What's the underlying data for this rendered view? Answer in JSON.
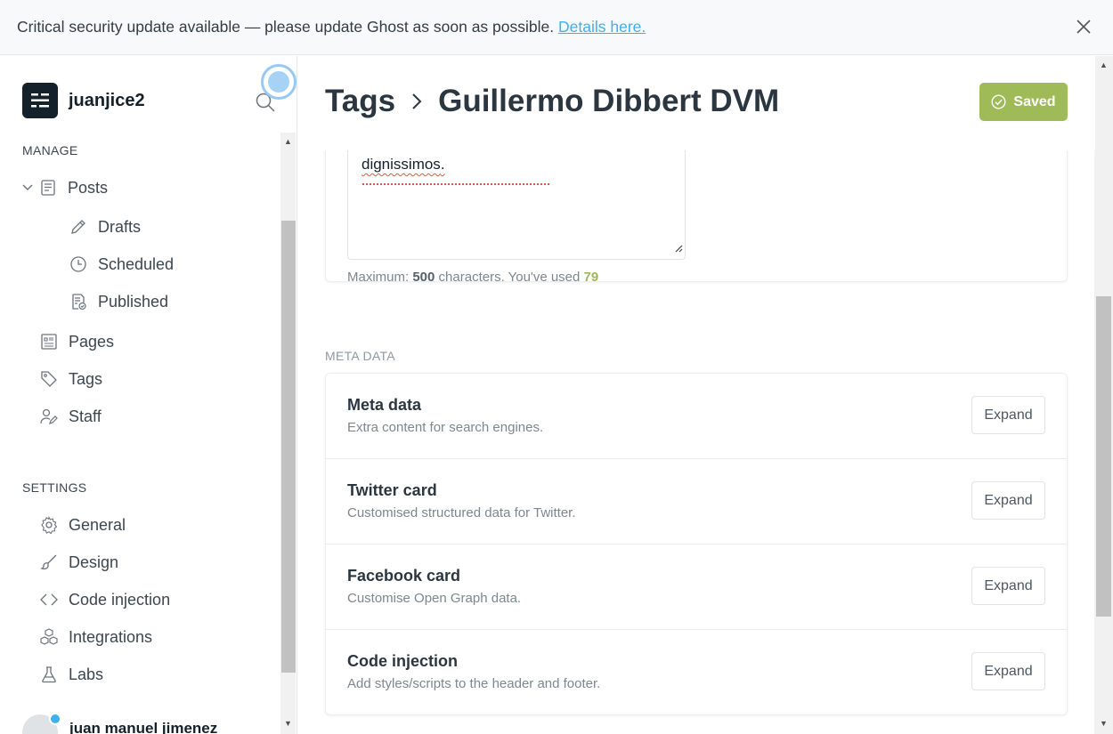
{
  "banner": {
    "message": "Critical security update available — please update Ghost as soon as possible.",
    "link": "Details here.",
    "close_icon": "close-icon"
  },
  "sidebar": {
    "site_name": "juanjice2",
    "manage_label": "MANAGE",
    "posts": {
      "label": "Posts",
      "subitems": [
        {
          "label": "Drafts",
          "icon": "pencil-icon"
        },
        {
          "label": "Scheduled",
          "icon": "clock-icon"
        },
        {
          "label": "Published",
          "icon": "published-icon"
        }
      ]
    },
    "manage_items": [
      {
        "label": "Pages",
        "icon": "pages-icon"
      },
      {
        "label": "Tags",
        "icon": "tag-icon"
      },
      {
        "label": "Staff",
        "icon": "staff-icon"
      }
    ],
    "settings_label": "SETTINGS",
    "settings_items": [
      {
        "label": "General",
        "icon": "gear-icon"
      },
      {
        "label": "Design",
        "icon": "brush-icon"
      },
      {
        "label": "Code injection",
        "icon": "code-icon"
      },
      {
        "label": "Integrations",
        "icon": "integrations-icon"
      },
      {
        "label": "Labs",
        "icon": "flask-icon"
      }
    ],
    "user_name": "juan manuel jimenez"
  },
  "header": {
    "breadcrumb_parent": "Tags",
    "breadcrumb_current": "Guillermo Dibbert DVM",
    "saved_label": "Saved"
  },
  "description": {
    "text_visible": "dignissimos",
    "char_max_label": "Maximum:",
    "char_max": "500",
    "char_used_label": "characters. You've used",
    "char_used": "79"
  },
  "meta": {
    "section_label": "META DATA",
    "rows": [
      {
        "title": "Meta data",
        "subtitle": "Extra content for search engines.",
        "button": "Expand"
      },
      {
        "title": "Twitter card",
        "subtitle": "Customised structured data for Twitter.",
        "button": "Expand"
      },
      {
        "title": "Facebook card",
        "subtitle": "Customise Open Graph data.",
        "button": "Expand"
      },
      {
        "title": "Code injection",
        "subtitle": "Add styles/scripts to the header and footer.",
        "button": "Expand"
      }
    ]
  },
  "colors": {
    "accent_green": "#9fbb58",
    "link_blue": "#3eb0ef",
    "text_dark": "#15212a"
  }
}
